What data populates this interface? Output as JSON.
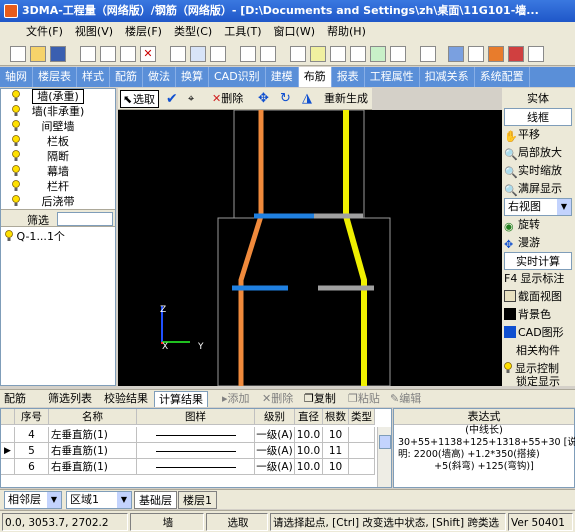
{
  "window": {
    "title": "3DMA-工程量（网络版）/钢筋（网络版）- [D:\\Documents and Settings\\zh\\桌面\\11G101-墙..."
  },
  "menu": [
    "文件(F)",
    "视图(V)",
    "楼层(F)",
    "类型(C)",
    "工具(T)",
    "窗口(W)",
    "帮助(H)"
  ],
  "tabs": [
    "轴网",
    "楼层表",
    "样式",
    "配筋",
    "做法",
    "换算",
    "CAD识别",
    "建模",
    "布筋",
    "报表",
    "工程属性",
    "扣减关系",
    "系统配置"
  ],
  "active_tab": "布筋",
  "left_panel": {
    "items": [
      "墙(承重)",
      "墙(非承重)",
      "间壁墙",
      "栏板",
      "隔断",
      "幕墙",
      "栏杆",
      "后浇带"
    ],
    "selected": "墙(承重)",
    "filter_label": "筛选",
    "filter_results": [
      {
        "name": "Q-1",
        "count": "1个"
      }
    ]
  },
  "draw_toolbar": {
    "select": "选取",
    "delete": "删除",
    "regenerate": "重新生成"
  },
  "right_panel": {
    "header": "实体",
    "mode_value": "线框",
    "pan": "平移",
    "zoom_local": "局部放大",
    "zoom_realtime": "实时缩放",
    "fit_screen": "满屏显示",
    "view_select": "右视图",
    "rotate": "旋转",
    "roam": "漫游",
    "realtime_calc": "实时计算",
    "f4_label": "显示标注",
    "f4_key": "F4",
    "section_view": "截面视图",
    "bg_color": "背景色",
    "cad_graphic": "CAD图形",
    "related_parts": "相关构件",
    "display_control": "显示控制",
    "lock_display": "锁定显示"
  },
  "canvas": {
    "axis_z": "Z",
    "axis_x": "X",
    "axis_y": "Y"
  },
  "bottom_tabs": [
    "配筋",
    "筛选列表",
    "校验结果",
    "计算结果"
  ],
  "bottom_active_tab": "计算结果",
  "bottom_actions": [
    "添加",
    "删除",
    "复制",
    "粘贴",
    "编辑"
  ],
  "table": {
    "headers": [
      "序号",
      "名称",
      "图样",
      "级别",
      "直径",
      "根数",
      "类型"
    ],
    "rows": [
      {
        "no": "4",
        "name": "左垂直筋(1)",
        "grade": "一级(A)",
        "dia": "10.0",
        "count": "10",
        "type": "",
        "current": false
      },
      {
        "no": "5",
        "name": "右垂直筋(1)",
        "grade": "一级(A)",
        "dia": "10.0",
        "count": "11",
        "type": "",
        "current": true
      },
      {
        "no": "6",
        "name": "右垂直筋(1)",
        "grade": "一级(A)",
        "dia": "10.0",
        "count": "10",
        "type": "",
        "current": false
      }
    ]
  },
  "expression": {
    "header": "表达式",
    "title": "(中线长)",
    "line1": "30+55+1138+125+1318+55+30 [说",
    "line2": "明: 2200(墙高) +1.2*350(搭接)",
    "line3": "+5(斜弯) +125(弯钩)]"
  },
  "status_row1": {
    "floor_combo": "相邻层",
    "region_combo": "区域1",
    "floor_tabs": [
      "基础层",
      "楼层1"
    ]
  },
  "status_row2": {
    "coords": "0.0, 3053.7, 2702.2",
    "type": "墙",
    "mode": "选取",
    "hint": "请选择起点, [Ctrl] 改变选中状态, [Shift] 跨类选",
    "version": "Ver 50401"
  },
  "colors": {
    "bar_orange": "#f08a3c",
    "bar_yellow": "#f0f000",
    "bar_blue": "#2080e0",
    "bar_gray": "#a0a0a0",
    "tab_blue": "#5a8fd8"
  }
}
